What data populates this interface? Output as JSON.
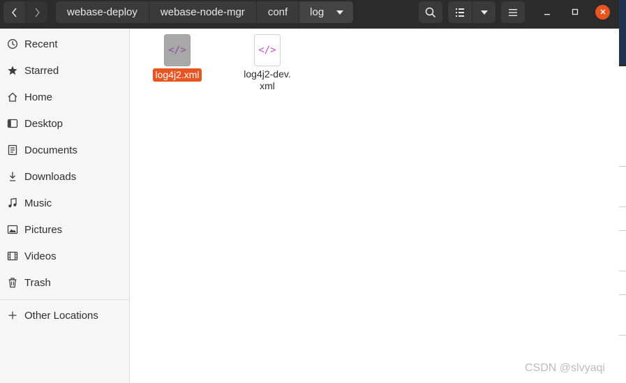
{
  "header": {
    "breadcrumbs": [
      "webase-deploy",
      "webase-node-mgr",
      "conf",
      "log"
    ]
  },
  "sidebar": {
    "items": [
      {
        "label": "Recent",
        "icon": "clock-icon"
      },
      {
        "label": "Starred",
        "icon": "star-icon"
      },
      {
        "label": "Home",
        "icon": "home-icon"
      },
      {
        "label": "Desktop",
        "icon": "desktop-icon"
      },
      {
        "label": "Documents",
        "icon": "document-icon"
      },
      {
        "label": "Downloads",
        "icon": "download-icon"
      },
      {
        "label": "Music",
        "icon": "music-icon"
      },
      {
        "label": "Pictures",
        "icon": "picture-icon"
      },
      {
        "label": "Videos",
        "icon": "video-icon"
      },
      {
        "label": "Trash",
        "icon": "trash-icon"
      }
    ],
    "other_locations": {
      "label": "Other Locations",
      "icon": "plus-icon"
    }
  },
  "files": [
    {
      "name": "log4j2.xml",
      "icon_glyph": "</>",
      "selected": true
    },
    {
      "name_line1": "log4j2-dev.",
      "name_line2": "xml",
      "icon_glyph": "</>",
      "selected": false
    }
  ],
  "watermark": "CSDN @slvyaqi",
  "colors": {
    "accent": "#e95420",
    "header_bg": "#2b2b2b",
    "xml_icon": "#c04fc8"
  }
}
